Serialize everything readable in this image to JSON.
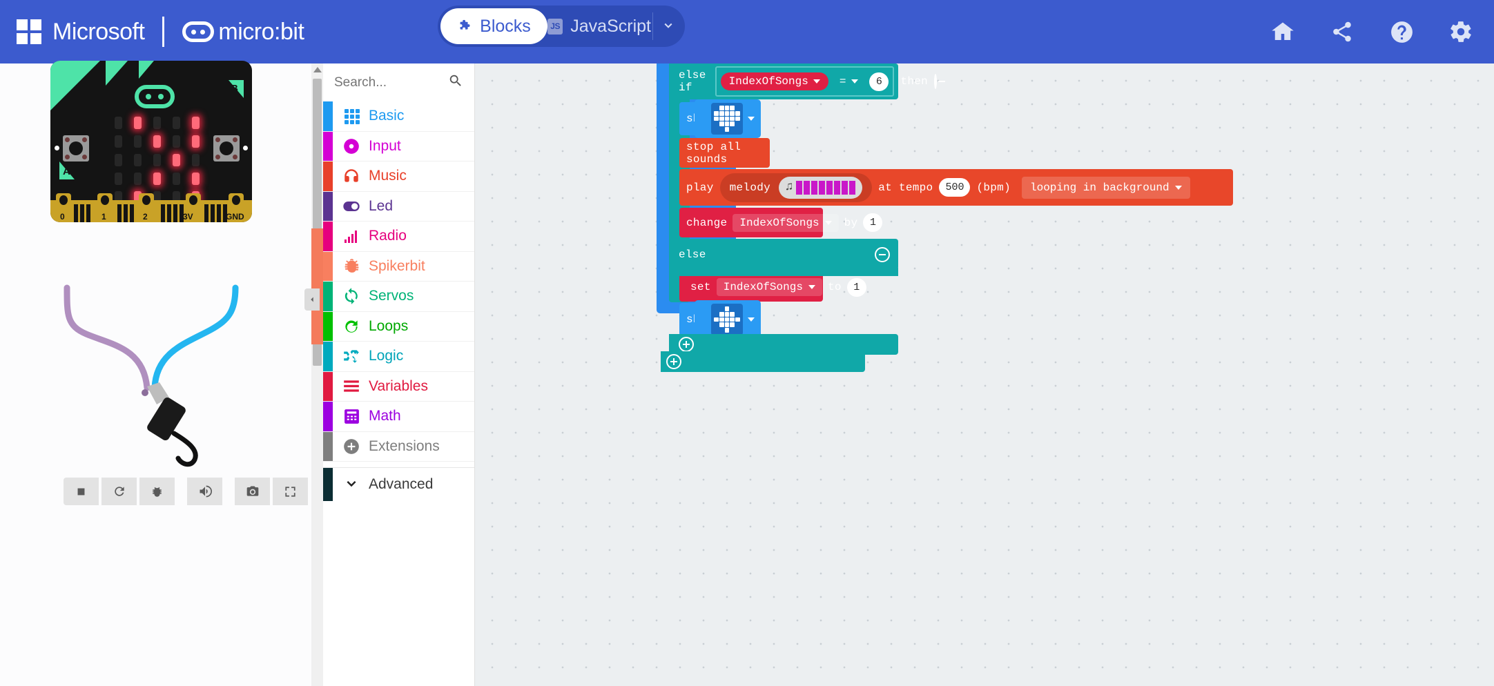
{
  "header": {
    "microsoft_label": "Microsoft",
    "microbit_label": "micro:bit",
    "tabs": [
      {
        "label": "Blocks",
        "icon": "puzzle-icon",
        "active": true
      },
      {
        "label": "JavaScript",
        "icon": "js-badge-icon",
        "active": false
      }
    ],
    "tab_caret": "chevron-down-icon",
    "actions": [
      {
        "name": "home-icon",
        "title": "Home"
      },
      {
        "name": "share-icon",
        "title": "Share"
      },
      {
        "name": "help-icon",
        "title": "Help"
      },
      {
        "name": "settings-gear-icon",
        "title": "Settings"
      }
    ],
    "bg_color": "#3C5BCE",
    "tab_bg_color": "#2E4BB5"
  },
  "simulator": {
    "board_label_a": "A",
    "board_label_b": "B",
    "pin_labels": [
      "0",
      "1",
      "2",
      "3V",
      "GND"
    ],
    "led_color_on": "#FF6B7A",
    "led_matrix": [
      [
        0,
        1,
        0,
        0,
        1
      ],
      [
        0,
        0,
        1,
        0,
        1
      ],
      [
        0,
        0,
        0,
        1,
        0
      ],
      [
        0,
        0,
        1,
        0,
        1
      ],
      [
        0,
        1,
        0,
        0,
        1
      ]
    ],
    "accent_green": "#4EE3A8",
    "wire_colors": {
      "purple": "#B08FBF",
      "blue": "#24B6F0"
    },
    "toolbar": [
      {
        "name": "stop-button",
        "icon": "stop-square-icon"
      },
      {
        "name": "restart-button",
        "icon": "refresh-icon"
      },
      {
        "name": "debug-button",
        "icon": "bug-icon"
      },
      {
        "name": "mute-button",
        "icon": "speaker-icon"
      },
      {
        "name": "screenshot-button",
        "icon": "camera-icon"
      },
      {
        "name": "fullscreen-button",
        "icon": "expand-icon"
      }
    ]
  },
  "toolbox": {
    "search_placeholder": "Search...",
    "search_value": "",
    "search_icon": "magnifier-icon",
    "categories": [
      {
        "label": "Basic",
        "color": "#1E9AF0",
        "text_color": "#1E9AF0",
        "icon": "grid-icon"
      },
      {
        "label": "Input",
        "color": "#D400D4",
        "text_color": "#D400D4",
        "icon": "donut-icon"
      },
      {
        "label": "Music",
        "color": "#E8402A",
        "text_color": "#E8402A",
        "icon": "headphones-icon"
      },
      {
        "label": "Led",
        "color": "#5B3391",
        "text_color": "#5B3391",
        "icon": "toggle-icon"
      },
      {
        "label": "Radio",
        "color": "#E6007E",
        "text_color": "#E6007E",
        "icon": "signal-bars-icon"
      },
      {
        "label": "Spikerbit",
        "color": "#F87F5F",
        "text_color": "#F87F5F",
        "icon": "bug-icon"
      },
      {
        "label": "Servos",
        "color": "#00B377",
        "text_color": "#00B377",
        "icon": "sync-icon"
      },
      {
        "label": "Loops",
        "color": "#00C000",
        "text_color": "#00A800",
        "icon": "loop-arrow-icon"
      },
      {
        "label": "Logic",
        "color": "#00AABE",
        "text_color": "#00A4B8",
        "icon": "shuffle-icon"
      },
      {
        "label": "Variables",
        "color": "#E01A40",
        "text_color": "#E01A40",
        "icon": "lines-icon"
      },
      {
        "label": "Math",
        "color": "#9C00E0",
        "text_color": "#9C00E0",
        "icon": "calculator-icon"
      },
      {
        "label": "Extensions",
        "color": "#7E7E7E",
        "text_color": "#7E7E7E",
        "icon": "plus-circle-icon"
      }
    ],
    "advanced": {
      "label": "Advanced",
      "color": "#0B2D33",
      "icon": "chevron-down-icon"
    },
    "collapse_handle": "chevron-left-icon"
  },
  "workspace": {
    "blocks": {
      "else_if": {
        "keyword": "else if",
        "variable": "IndexOfSongs",
        "operator": "=",
        "value": "6",
        "then_keyword": "then",
        "collapse_icon": "minus-circle-icon"
      },
      "show_icon_1": {
        "label": "show icon",
        "field_icon": "led-pattern-field"
      },
      "stop_all_sounds": {
        "label": "stop all sounds"
      },
      "play_melody": {
        "play_label": "play",
        "melody_label": "melody",
        "melody_field": "melody-note-bars",
        "tempo_label": "at tempo",
        "tempo_value": "500",
        "bpm_label": "(bpm)",
        "mode": "looping in background"
      },
      "change_var": {
        "label": "change",
        "variable": "IndexOfSongs",
        "by_label": "by",
        "value": "1"
      },
      "else": {
        "keyword": "else",
        "collapse_icon": "minus-circle-icon"
      },
      "set_var": {
        "label": "set",
        "variable": "IndexOfSongs",
        "to_label": "to",
        "value": "1",
        "icon": "variable-icon"
      },
      "show_icon_2": {
        "label": "show icon",
        "field_icon": "led-pattern-field"
      },
      "add_icons": [
        "plus-circle-icon",
        "plus-circle-icon"
      ]
    },
    "colors": {
      "logic": "#10A8A8",
      "basic": "#2B9BF4",
      "music": "#E8472A",
      "variables": "#E02044",
      "background": "#ECEFF1"
    }
  }
}
